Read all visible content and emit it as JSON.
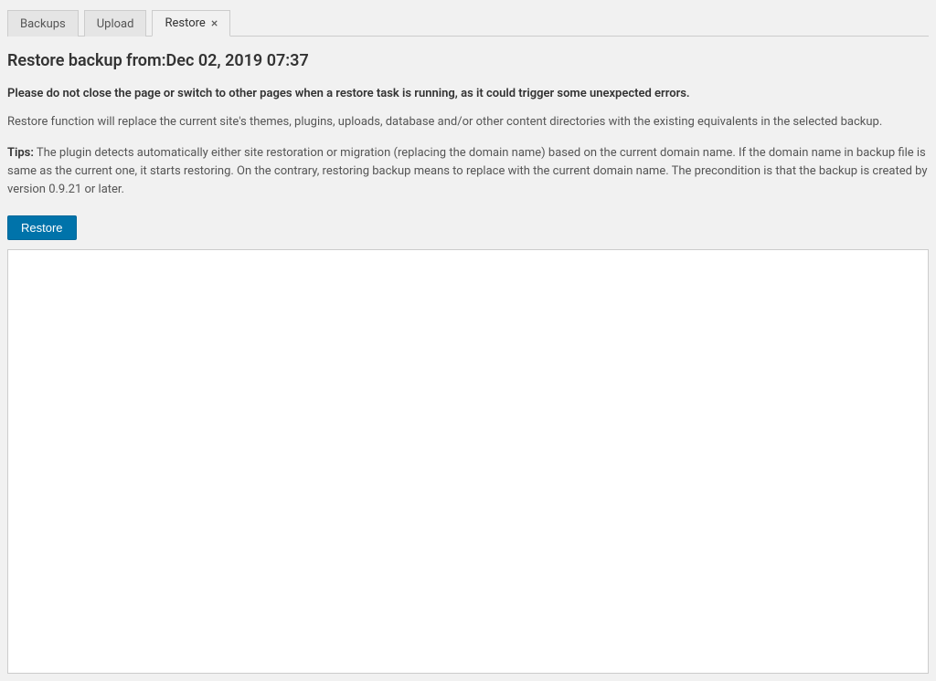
{
  "tabs": {
    "backups": "Backups",
    "upload": "Upload",
    "restore": "Restore"
  },
  "header": {
    "title_prefix": "Restore backup from:",
    "title_date": "Dec 02, 2019 07:37"
  },
  "messages": {
    "warning": "Please do not close the page or switch to other pages when a restore task is running, as it could trigger some unexpected errors.",
    "description": "Restore function will replace the current site's themes, plugins, uploads, database and/or other content directories with the existing equivalents in the selected backup.",
    "tips_label": "Tips:",
    "tips_body": " The plugin detects automatically either site restoration or migration (replacing the domain name) based on the current domain name. If the domain name in backup file is same as the current one, it starts restoring. On the contrary, restoring backup means to replace with the current domain name. The precondition is that the backup is created by version 0.9.21 or later."
  },
  "actions": {
    "restore_button": "Restore"
  }
}
